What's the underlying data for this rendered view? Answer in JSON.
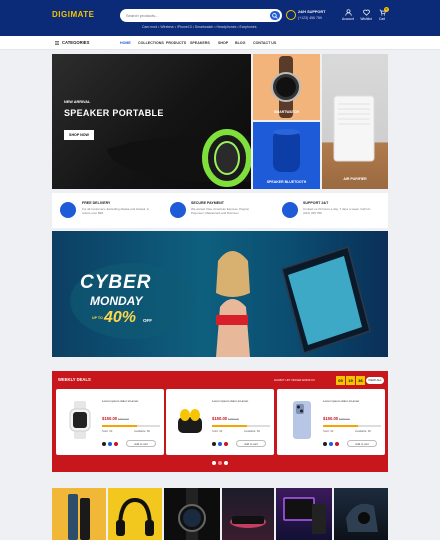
{
  "header": {
    "logo_main": "DIGIMATE",
    "search_placeholder": "Search products...",
    "quick_links": "Cam mod  •  Wireless  •  iPhone13  •  Smartwatch  •  Headphones  •  Earphones",
    "support_title": "24/H SUPPORT",
    "support_phone": "(+123) 456 789",
    "icons": [
      {
        "name": "account",
        "label": "Account"
      },
      {
        "name": "wishlist",
        "label": "Wishlist"
      },
      {
        "name": "cart",
        "label": "Cart",
        "count": "0"
      }
    ]
  },
  "nav": {
    "categories_label": "CATEGORIES",
    "items": [
      "HOME",
      "COLLECTIONS",
      "PRODUCTS",
      "SPEAKERS",
      "SHOP",
      "BLOG",
      "CONTACT US"
    ]
  },
  "hero": {
    "kicker": "NEW ARRIVAL",
    "title": "SPEAKER PORTABLE",
    "button": "SHOP NOW",
    "tiles": [
      {
        "label": "SMARTWATCH"
      },
      {
        "label": "SPEAKER BLUETOOTH"
      },
      {
        "label": "AIR PURIFIER"
      }
    ]
  },
  "features": [
    {
      "title": "FREE DELIVERY",
      "desc": "For all customers. Excluding Alaska and Hawaii, in orders over $99"
    },
    {
      "title": "SECURE PAYMENT",
      "desc": "We accept Visa, American Express, Paypal, Payoneer, Mastercard and Discover"
    },
    {
      "title": "SUPPORT 24/7",
      "desc": "Contact us 24 hours a day, 7 days a week. Call Us: (012) 345 789"
    }
  ],
  "banner": {
    "line1": "CYBER",
    "line2": "MONDAY",
    "upto": "UP TO",
    "percent": "40%",
    "off": "OFF"
  },
  "deals": {
    "title": "WEEKLY DEALS",
    "countdown_text": "HURRY UP! OFFER ENDS IN:",
    "timer": [
      "05",
      "19",
      "36"
    ],
    "view_all": "VIEW ALL",
    "products": [
      {
        "name": "Lorem ipsum dolor sit amet",
        "price": "$150.00",
        "old": "$250.00",
        "sold": "Sold: 40",
        "avail": "Available: 60",
        "progress": 0.6,
        "button": "Add to cart",
        "swatches": [
          "#1d1d1d",
          "#1e5bd8",
          "#c8161d"
        ]
      },
      {
        "name": "Lorem ipsum dolor sit amet",
        "price": "$150.00",
        "old": "$250.00",
        "sold": "Sold: 40",
        "avail": "Available: 60",
        "progress": 0.6,
        "button": "Add to cart",
        "swatches": [
          "#1d1d1d",
          "#1e5bd8",
          "#c8161d"
        ]
      },
      {
        "name": "Lorem ipsum dolor sit amet",
        "price": "$150.00",
        "old": "$250.00",
        "sold": "Sold: 40",
        "avail": "Available: 60",
        "progress": 0.6,
        "button": "Add to cart",
        "swatches": [
          "#1d1d1d",
          "#1e5bd8",
          "#c8161d"
        ]
      }
    ]
  },
  "colors": {
    "navy": "#0b2a78",
    "accent": "#f6c400",
    "deal_red": "#c8161d",
    "blue": "#1e5bd8"
  }
}
